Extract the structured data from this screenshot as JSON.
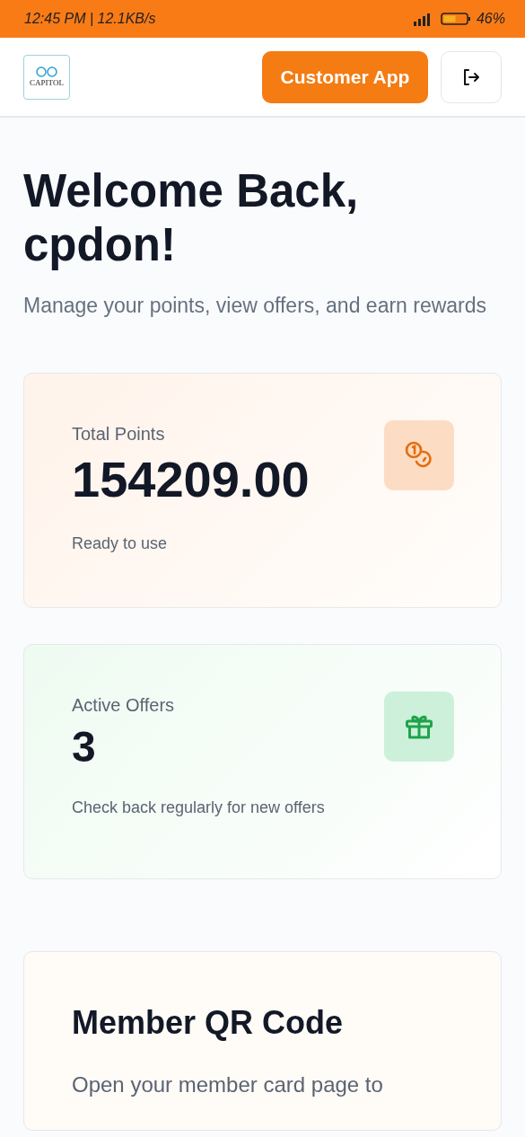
{
  "status_bar": {
    "time": "12:45 PM | 12.1KB/s",
    "battery": "46%"
  },
  "header": {
    "logo": "CAPITOL",
    "button": "Customer App"
  },
  "welcome": {
    "title": "Welcome Back, cpdon!",
    "subtitle": "Manage your points, view offers, and earn rewards"
  },
  "stats": [
    {
      "kind": "points",
      "label": "Total Points",
      "value": "154209.00",
      "note": "Ready to use"
    },
    {
      "kind": "offers",
      "label": "Active Offers",
      "value": "3",
      "note": "Check back regularly for new offers"
    }
  ],
  "qr_card": {
    "title": "Member QR Code",
    "text": "Open your member card page to"
  }
}
